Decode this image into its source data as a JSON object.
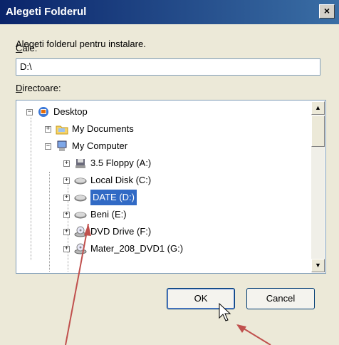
{
  "window": {
    "title": "Alegeti Folderul",
    "close_label": "×"
  },
  "instruction": "Alegeti folderul pentru instalare.",
  "path": {
    "label_access": "C",
    "label_rest": "ale:",
    "value": "D:\\"
  },
  "directories": {
    "label_access": "D",
    "label_rest": "irectoare:"
  },
  "tree": [
    {
      "label": "Desktop",
      "icon": "desktop-icon",
      "expander": "−"
    },
    {
      "label": "My Documents",
      "icon": "folder-icon",
      "expander": "+"
    },
    {
      "label": "My Computer",
      "icon": "computer-icon",
      "expander": "−"
    },
    {
      "label": "3.5 Floppy (A:)",
      "icon": "floppy-icon",
      "expander": "+"
    },
    {
      "label": "Local Disk (C:)",
      "icon": "harddisk-icon",
      "expander": "+"
    },
    {
      "label": "DATE (D:)",
      "icon": "harddisk-icon",
      "expander": "+",
      "selected": true
    },
    {
      "label": "Beni (E:)",
      "icon": "harddisk-icon",
      "expander": "+"
    },
    {
      "label": "DVD Drive (F:)",
      "icon": "dvd-icon",
      "expander": "+"
    },
    {
      "label": "Mater_208_DVD1 (G:)",
      "icon": "dvd-icon",
      "expander": "+"
    }
  ],
  "buttons": {
    "ok": "OK",
    "cancel": "Cancel"
  },
  "colors": {
    "selection": "#316ac5",
    "annotation_arrow": "#c0504d",
    "title_bar": "#0a246a"
  }
}
